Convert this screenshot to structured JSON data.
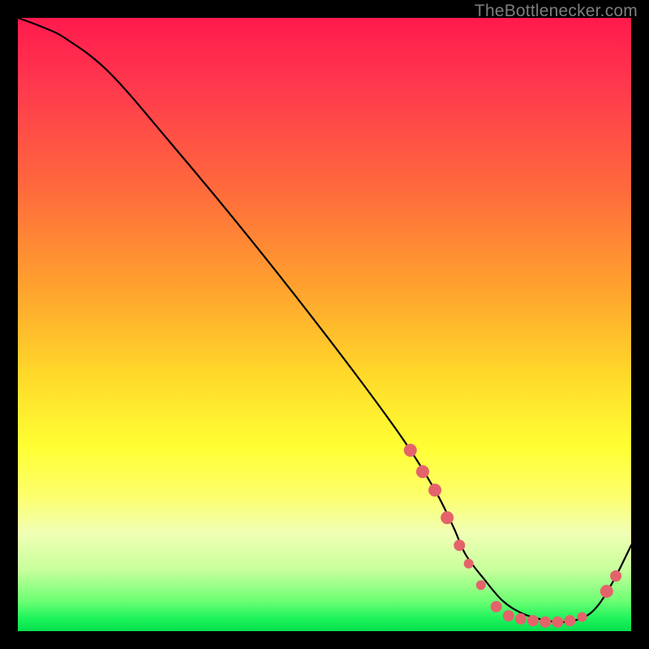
{
  "watermark": "TheBottlenecker.com",
  "chart_data": {
    "type": "line",
    "title": "",
    "xlabel": "",
    "ylabel": "",
    "xlim": [
      0,
      100
    ],
    "ylim": [
      0,
      100
    ],
    "series": [
      {
        "name": "bottleneck-curve",
        "x": [
          0,
          4,
          8,
          15,
          25,
          35,
          45,
          55,
          63,
          68,
          71,
          73,
          76,
          79,
          82,
          85,
          88,
          91,
          94,
          97,
          100
        ],
        "y": [
          100,
          98.5,
          96.5,
          91,
          79.5,
          67.5,
          55,
          42,
          31,
          23,
          17,
          12.5,
          8.5,
          5,
          3,
          2,
          1.5,
          1.8,
          3.5,
          8,
          14
        ]
      }
    ],
    "markers": {
      "name": "highlighted-points",
      "points": [
        {
          "x": 64,
          "y": 29.5,
          "r": 8
        },
        {
          "x": 66,
          "y": 26,
          "r": 8
        },
        {
          "x": 68,
          "y": 23,
          "r": 8
        },
        {
          "x": 70,
          "y": 18.5,
          "r": 8
        },
        {
          "x": 72,
          "y": 14,
          "r": 7
        },
        {
          "x": 73.5,
          "y": 11,
          "r": 6
        },
        {
          "x": 75.5,
          "y": 7.5,
          "r": 6
        },
        {
          "x": 78,
          "y": 4,
          "r": 7
        },
        {
          "x": 80,
          "y": 2.5,
          "r": 7
        },
        {
          "x": 82,
          "y": 2,
          "r": 7
        },
        {
          "x": 84,
          "y": 1.7,
          "r": 7
        },
        {
          "x": 86,
          "y": 1.5,
          "r": 7
        },
        {
          "x": 88,
          "y": 1.5,
          "r": 7
        },
        {
          "x": 90,
          "y": 1.7,
          "r": 7
        },
        {
          "x": 92,
          "y": 2.3,
          "r": 6
        },
        {
          "x": 96,
          "y": 6.5,
          "r": 8
        },
        {
          "x": 97.5,
          "y": 9,
          "r": 7
        }
      ]
    },
    "gradient_stops": [
      {
        "pos": 0,
        "color": "#ff1a4d"
      },
      {
        "pos": 12,
        "color": "#ff3b4d"
      },
      {
        "pos": 28,
        "color": "#ff6a3c"
      },
      {
        "pos": 44,
        "color": "#ffa22e"
      },
      {
        "pos": 58,
        "color": "#ffd82a"
      },
      {
        "pos": 70,
        "color": "#ffff33"
      },
      {
        "pos": 78,
        "color": "#fdff6d"
      },
      {
        "pos": 84,
        "color": "#f0ffb4"
      },
      {
        "pos": 90,
        "color": "#c8ff9c"
      },
      {
        "pos": 95,
        "color": "#6eff74"
      },
      {
        "pos": 98,
        "color": "#1cf35b"
      },
      {
        "pos": 100,
        "color": "#08df4e"
      }
    ]
  }
}
